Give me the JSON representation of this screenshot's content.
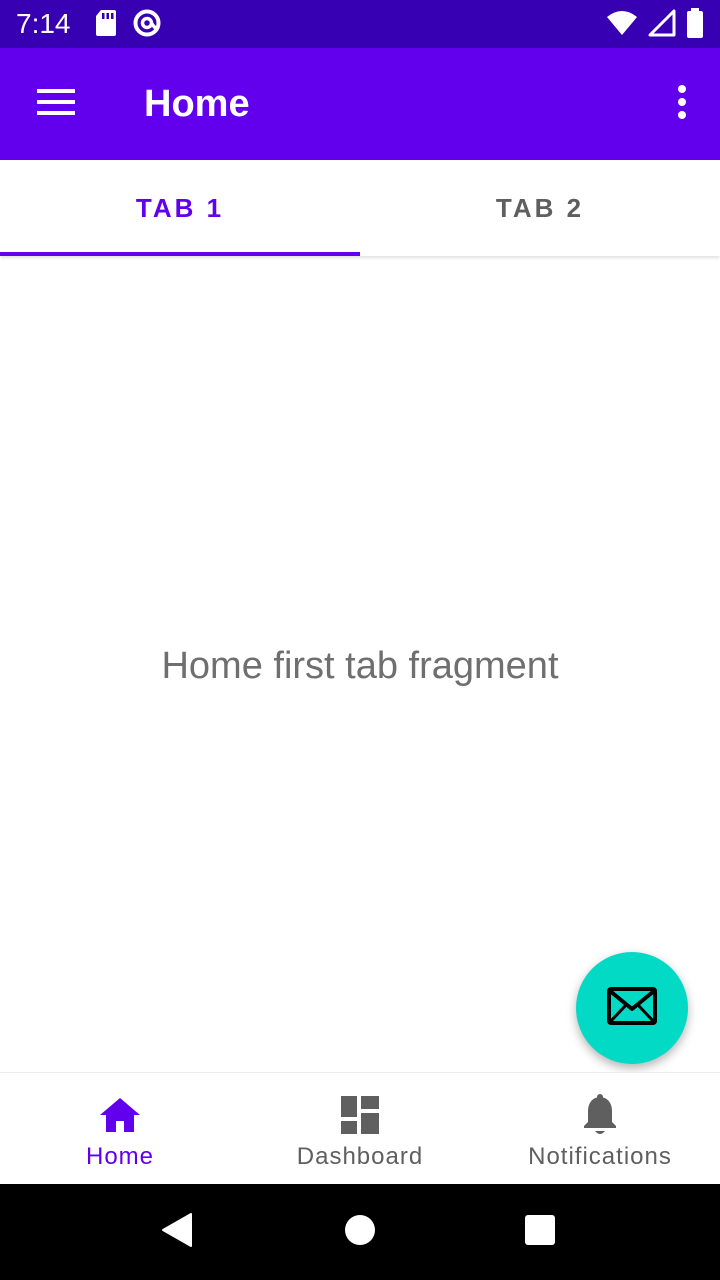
{
  "status_bar": {
    "time": "7:14",
    "icons": [
      "sd-card-icon",
      "at-sign-icon",
      "wifi-icon",
      "signal-icon",
      "battery-icon"
    ]
  },
  "app_bar": {
    "title": "Home",
    "menu_icon": "hamburger-menu-icon",
    "overflow_icon": "more-vert-icon"
  },
  "tabs": [
    {
      "label": "TAB 1",
      "selected": true
    },
    {
      "label": "TAB 2",
      "selected": false
    }
  ],
  "content": {
    "message": "Home first tab fragment"
  },
  "fab": {
    "icon": "mail-icon"
  },
  "bottom_nav": {
    "items": [
      {
        "label": "Home",
        "icon": "home-icon",
        "selected": true
      },
      {
        "label": "Dashboard",
        "icon": "dashboard-icon",
        "selected": false
      },
      {
        "label": "Notifications",
        "icon": "bell-icon",
        "selected": false
      }
    ]
  },
  "system_nav": {
    "buttons": [
      "back-icon",
      "home-circle-icon",
      "recents-icon"
    ]
  },
  "colors": {
    "primary": "#6200EE",
    "primary_dark": "#3700B3",
    "accent": "#03DAC5",
    "inactive": "#5f5f5f"
  }
}
